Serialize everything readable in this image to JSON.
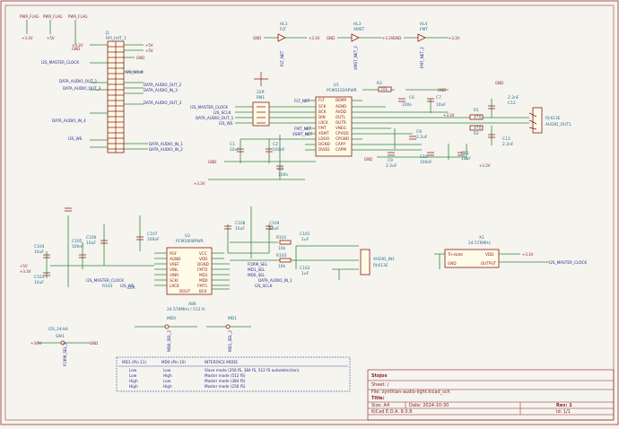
{
  "schematic": {
    "power_flags": [
      "PWR_FLAG",
      "PWR_FLAG",
      "PWR_FLAG"
    ],
    "power_rails": [
      "+3.3V",
      "+5V",
      "GND",
      "+5V",
      "+3.3V"
    ],
    "j1": {
      "ref": "J1",
      "value": "RPi_HAT_1",
      "labels": {
        "i2s_master_clock": "I2S_MASTER_CLOCK",
        "i2s_sclk": "I2S_SCLK",
        "data_audio_out_1": "DATA_AUDIO_OUT_1",
        "data_audio_out_2": "DATA_AUDIO_OUT_2",
        "data_audio_in_3": "DATA_AUDIO_IN_3",
        "data_audio_out_3": "DATA_AUDIO_OUT_3",
        "i2s_ws": "I2S_WS",
        "data_audio_in_4": "DATA_AUDIO_IN_4",
        "data_audio_in_1": "DATA_AUDIO_IN_1",
        "data_audio_in_2": "DATA_AUDIO_IN_2"
      }
    },
    "hl1": {
      "ref": "HL1",
      "value": "FLT",
      "net": "FLT_NET"
    },
    "hl3": {
      "ref": "HL3",
      "value": "XMST",
      "net": "XMST_NET_2"
    },
    "hl4": {
      "ref": "HL4",
      "value": "FMT",
      "net": "FMT_NET_2"
    },
    "u1": {
      "ref": "U1",
      "value": "PCM5102APWR",
      "pins_left": [
        "FLT",
        "SCK",
        "BCK",
        "DIN",
        "LRCK",
        "FMT",
        "XSMT",
        "LDOO",
        "DGND",
        "DVDD"
      ],
      "pins_right": [
        "DEMP",
        "AGND",
        "AVDD",
        "OUTL",
        "OUTR",
        "VNEG",
        "CPVDD",
        "CPGND",
        "CAPP",
        "CAPM"
      ]
    },
    "u1_labels": {
      "master": "I2S_MASTER_CLOCK",
      "sclk": "I2S_SCLK",
      "data": "DATA_AUDIO_OUT_1",
      "ws": "I2S_WS",
      "flt": "FLT_NET",
      "fmt": "FMT_NET",
      "xsmt": "XSMT_NET"
    },
    "rn1": {
      "ref": "RN1",
      "value": "22R"
    },
    "out_passives": {
      "r3": "R3",
      "r3v": "10k",
      "c6": "C6",
      "c6v": "100n",
      "c7": "C7",
      "c7v": "10uF",
      "r1": "R1",
      "r1v": "470",
      "c12": "C12",
      "c12v": "2.2nF",
      "r2": "R2",
      "r2v": "470",
      "c13": "C13",
      "c13v": "2.2nF",
      "c8": "C8",
      "c8v": "2.2uF",
      "c9": "C9",
      "c9v": "2.2uF",
      "c10": "C10",
      "c10v": "100nF",
      "c11": "C11",
      "c11v": "10uF",
      "c1": "C1",
      "c1v": "10uF",
      "c2": "C2",
      "c2v": "100nF",
      "c3": "C3",
      "c3v": "100n"
    },
    "j_out": {
      "ref": "J2",
      "value": "PJ-613E",
      "label": "AUDIO_OUT1"
    },
    "u2": {
      "ref": "U2",
      "value": "PCM1808PWR",
      "pins_left": [
        "PGF",
        "AGND",
        "VREF",
        "VINL",
        "VINR",
        "SCKI",
        "LRCK"
      ],
      "pins_right": [
        "VCC",
        "VDD",
        "DGND",
        "FMT0",
        "MD1",
        "MD0",
        "FMT1",
        "DOUT",
        "BCK"
      ]
    },
    "u2_labels": {
      "fmt": "FORM_SEL",
      "md1": "MD1_SEL",
      "md0": "MD0_SEL",
      "data": "DATA_AUDIO_IN_1",
      "sclk": "I2S_SCLK",
      "master": "I2S_MASTER_CLOCK",
      "ws": "I2S_WS"
    },
    "in_passives": {
      "c103": "C103",
      "c104": "C104",
      "c104v": "10uF",
      "c105": "C105",
      "c105v": "100nF",
      "c106": "C106",
      "c106v": "10uF",
      "c107": "C107",
      "c107v": "100nF",
      "c108": "C108",
      "c108v": "10uF",
      "c109": "C109",
      "c109v": "10uF",
      "c101": "C101",
      "c101v": "1uF",
      "c102": "C102",
      "c102v": "1uF",
      "r101": "R101",
      "r101v": "10k",
      "r102": "R102",
      "r102v": "10k",
      "r103": "R103",
      "r103v": "22R"
    },
    "j_in": {
      "ref": "J3",
      "value": "PJ-613E",
      "label": "AUDIO_IN1"
    },
    "x1": {
      "ref": "X1",
      "value": "24.576MHz",
      "pins": [
        "Tri-state",
        "VDD",
        "GND",
        "OUTPUT"
      ],
      "out": "I2S_MASTER_CLOCK"
    },
    "x1_freq": "24.576MHz / 512 fs",
    "sw": {
      "ref": "SW1",
      "value": "I2S_24-bit",
      "md0": "MD0",
      "md1": "MD1",
      "md0_net": "MD0_SEL_2",
      "md1_net": "MD1_SEL_2",
      "form": "FORM_SEL_2"
    },
    "table": {
      "headers": [
        "MD1 (Pin 11)",
        "MD0 (Pin 10)",
        "INTERFACE MODE"
      ],
      "rows": [
        [
          "Low",
          "Low",
          "Slave mode (256 fS, 384 fS, 512 fS autodetection)"
        ],
        [
          "Low",
          "High",
          "Master mode (512 fS)"
        ],
        [
          "High",
          "Low",
          "Master mode (384 fS)"
        ],
        [
          "High",
          "High",
          "Master mode (256 fS)"
        ]
      ]
    },
    "title_block": {
      "company": "Stojos",
      "sheet": "Sheet: /",
      "file": "File: zynthian-audio-light.kicad_sch",
      "title_label": "Title:",
      "size": "Size: A4",
      "date": "Date: 2024-10-30",
      "rev": "Rev: 1",
      "tool": "KiCad E.D.A. 8.0.8",
      "id": "Id: 1/1"
    }
  }
}
